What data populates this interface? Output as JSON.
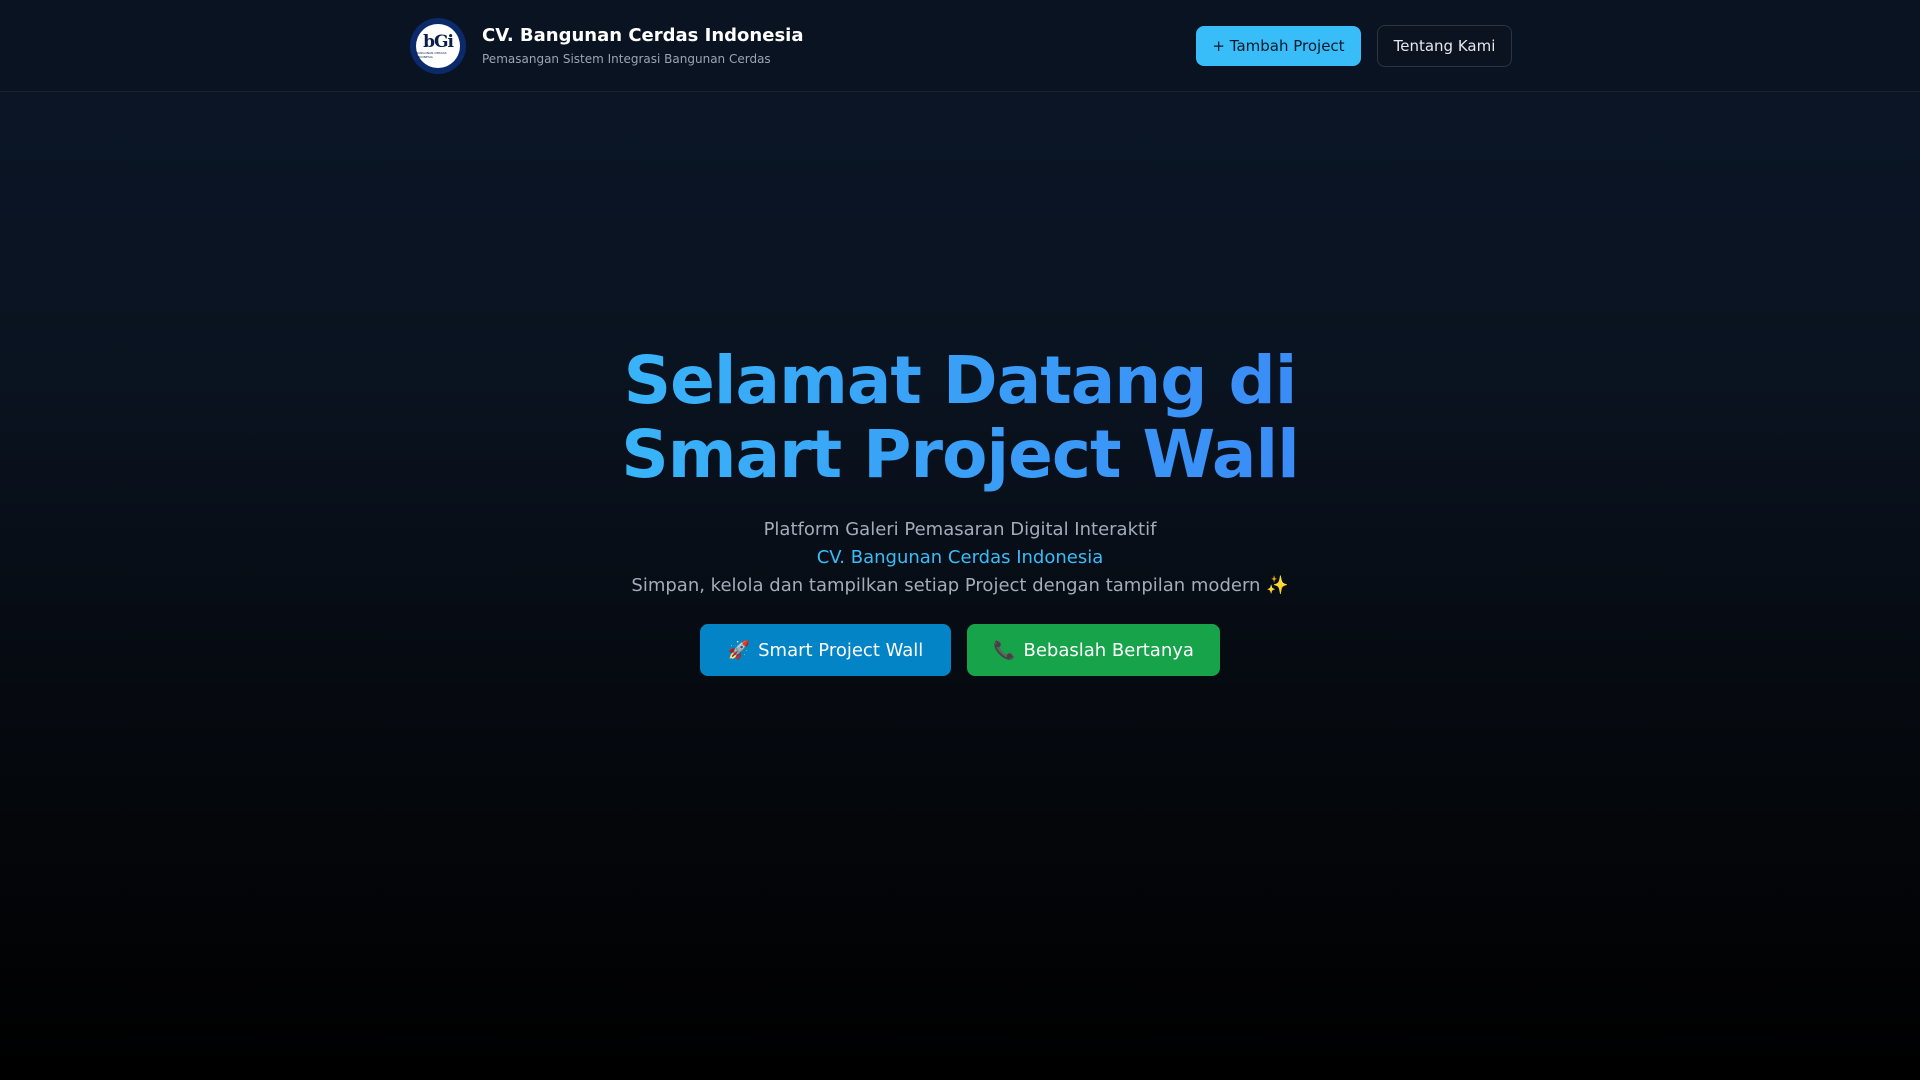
{
  "header": {
    "logo": {
      "icon": "company-logo",
      "letters": "bGi",
      "caption": "BANGUNAN CERDAS INDONESIA"
    },
    "title": "CV. Bangunan Cerdas Indonesia",
    "subtitle": "Pemasangan Sistem Integrasi Bangunan Cerdas",
    "add_project_label": "+ Tambah Project",
    "about_label": "Tentang Kami"
  },
  "hero": {
    "title_line1": "Selamat Datang di",
    "title_line2": "Smart Project Wall",
    "line1": "Platform Galeri Pemasaran Digital Interaktif",
    "line2": "CV. Bangunan Cerdas Indonesia",
    "line3": "Simpan, kelola dan tampilkan setiap Project dengan tampilan modern ✨",
    "cta_wall": {
      "icon": "🚀",
      "icon_name": "rocket-icon",
      "label": "Smart Project Wall"
    },
    "cta_ask": {
      "icon": "📞",
      "icon_name": "phone-icon",
      "label": "Bebaslah Bertanya"
    }
  },
  "colors": {
    "accent": "#38bdf8",
    "accent_blue": "#3b82f6",
    "primary_button": "#0284c7",
    "success_button": "#16a34a",
    "background": "#0b1628"
  }
}
